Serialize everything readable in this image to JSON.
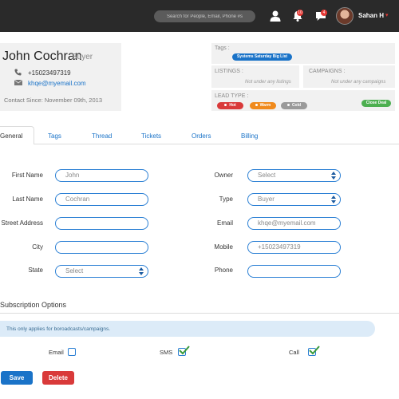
{
  "topbar": {
    "search_placeholder": "Search for People, Email, Phone #s",
    "notifications_badge": "10",
    "messages_badge": "4",
    "user_name": "Sahan H",
    "user_caret": "▾"
  },
  "contact": {
    "name": "John Cochran",
    "role": "Buyer",
    "phone": "+15023497319",
    "email": "khqe@myemail.com",
    "since": "Contact Since: November 09th, 2013"
  },
  "tags_panel": {
    "label": "Tags :",
    "tag": "Systems Saturday Big List"
  },
  "listings_panel": {
    "label": "LISTINGS :",
    "note": "Not under any listings"
  },
  "campaigns_panel": {
    "label": "CAMPAIGNS :",
    "note": "Not under any campaigns"
  },
  "lead_panel": {
    "label": "LEAD TYPE :",
    "types": [
      {
        "label": "Hot",
        "color": "#d93a3a"
      },
      {
        "label": "Warm",
        "color": "#f08a1c"
      },
      {
        "label": "Cold",
        "color": "#9a9a9a"
      }
    ],
    "close_deal": "Close Deal",
    "close_deal_color": "#4caf50"
  },
  "tabs": [
    "General",
    "Tags",
    "Thread",
    "Tickets",
    "Orders",
    "Billing"
  ],
  "form": {
    "first_name": {
      "label": "First Name",
      "value": "John"
    },
    "last_name": {
      "label": "Last Name",
      "value": "Cochran"
    },
    "street": {
      "label": "Street Address",
      "value": ""
    },
    "city": {
      "label": "City",
      "value": ""
    },
    "state": {
      "label": "State",
      "value": "Select"
    },
    "owner": {
      "label": "Owner",
      "value": "Select"
    },
    "type": {
      "label": "Type",
      "value": "Buyer"
    },
    "email": {
      "label": "Email",
      "value": "khqe@myemail.com"
    },
    "mobile": {
      "label": "Mobile",
      "value": "+15023497319"
    },
    "phone": {
      "label": "Phone",
      "value": ""
    }
  },
  "subscription": {
    "title": "Subscription Options",
    "info": "This only applies for boroadcasts/campaigns.",
    "options": [
      {
        "label": "Email",
        "checked": false
      },
      {
        "label": "SMS",
        "checked": true
      },
      {
        "label": "Call",
        "checked": true
      }
    ]
  },
  "buttons": {
    "save": "Save",
    "delete": "Delete",
    "save_color": "#1a73c8",
    "delete_color": "#d93a3a"
  }
}
